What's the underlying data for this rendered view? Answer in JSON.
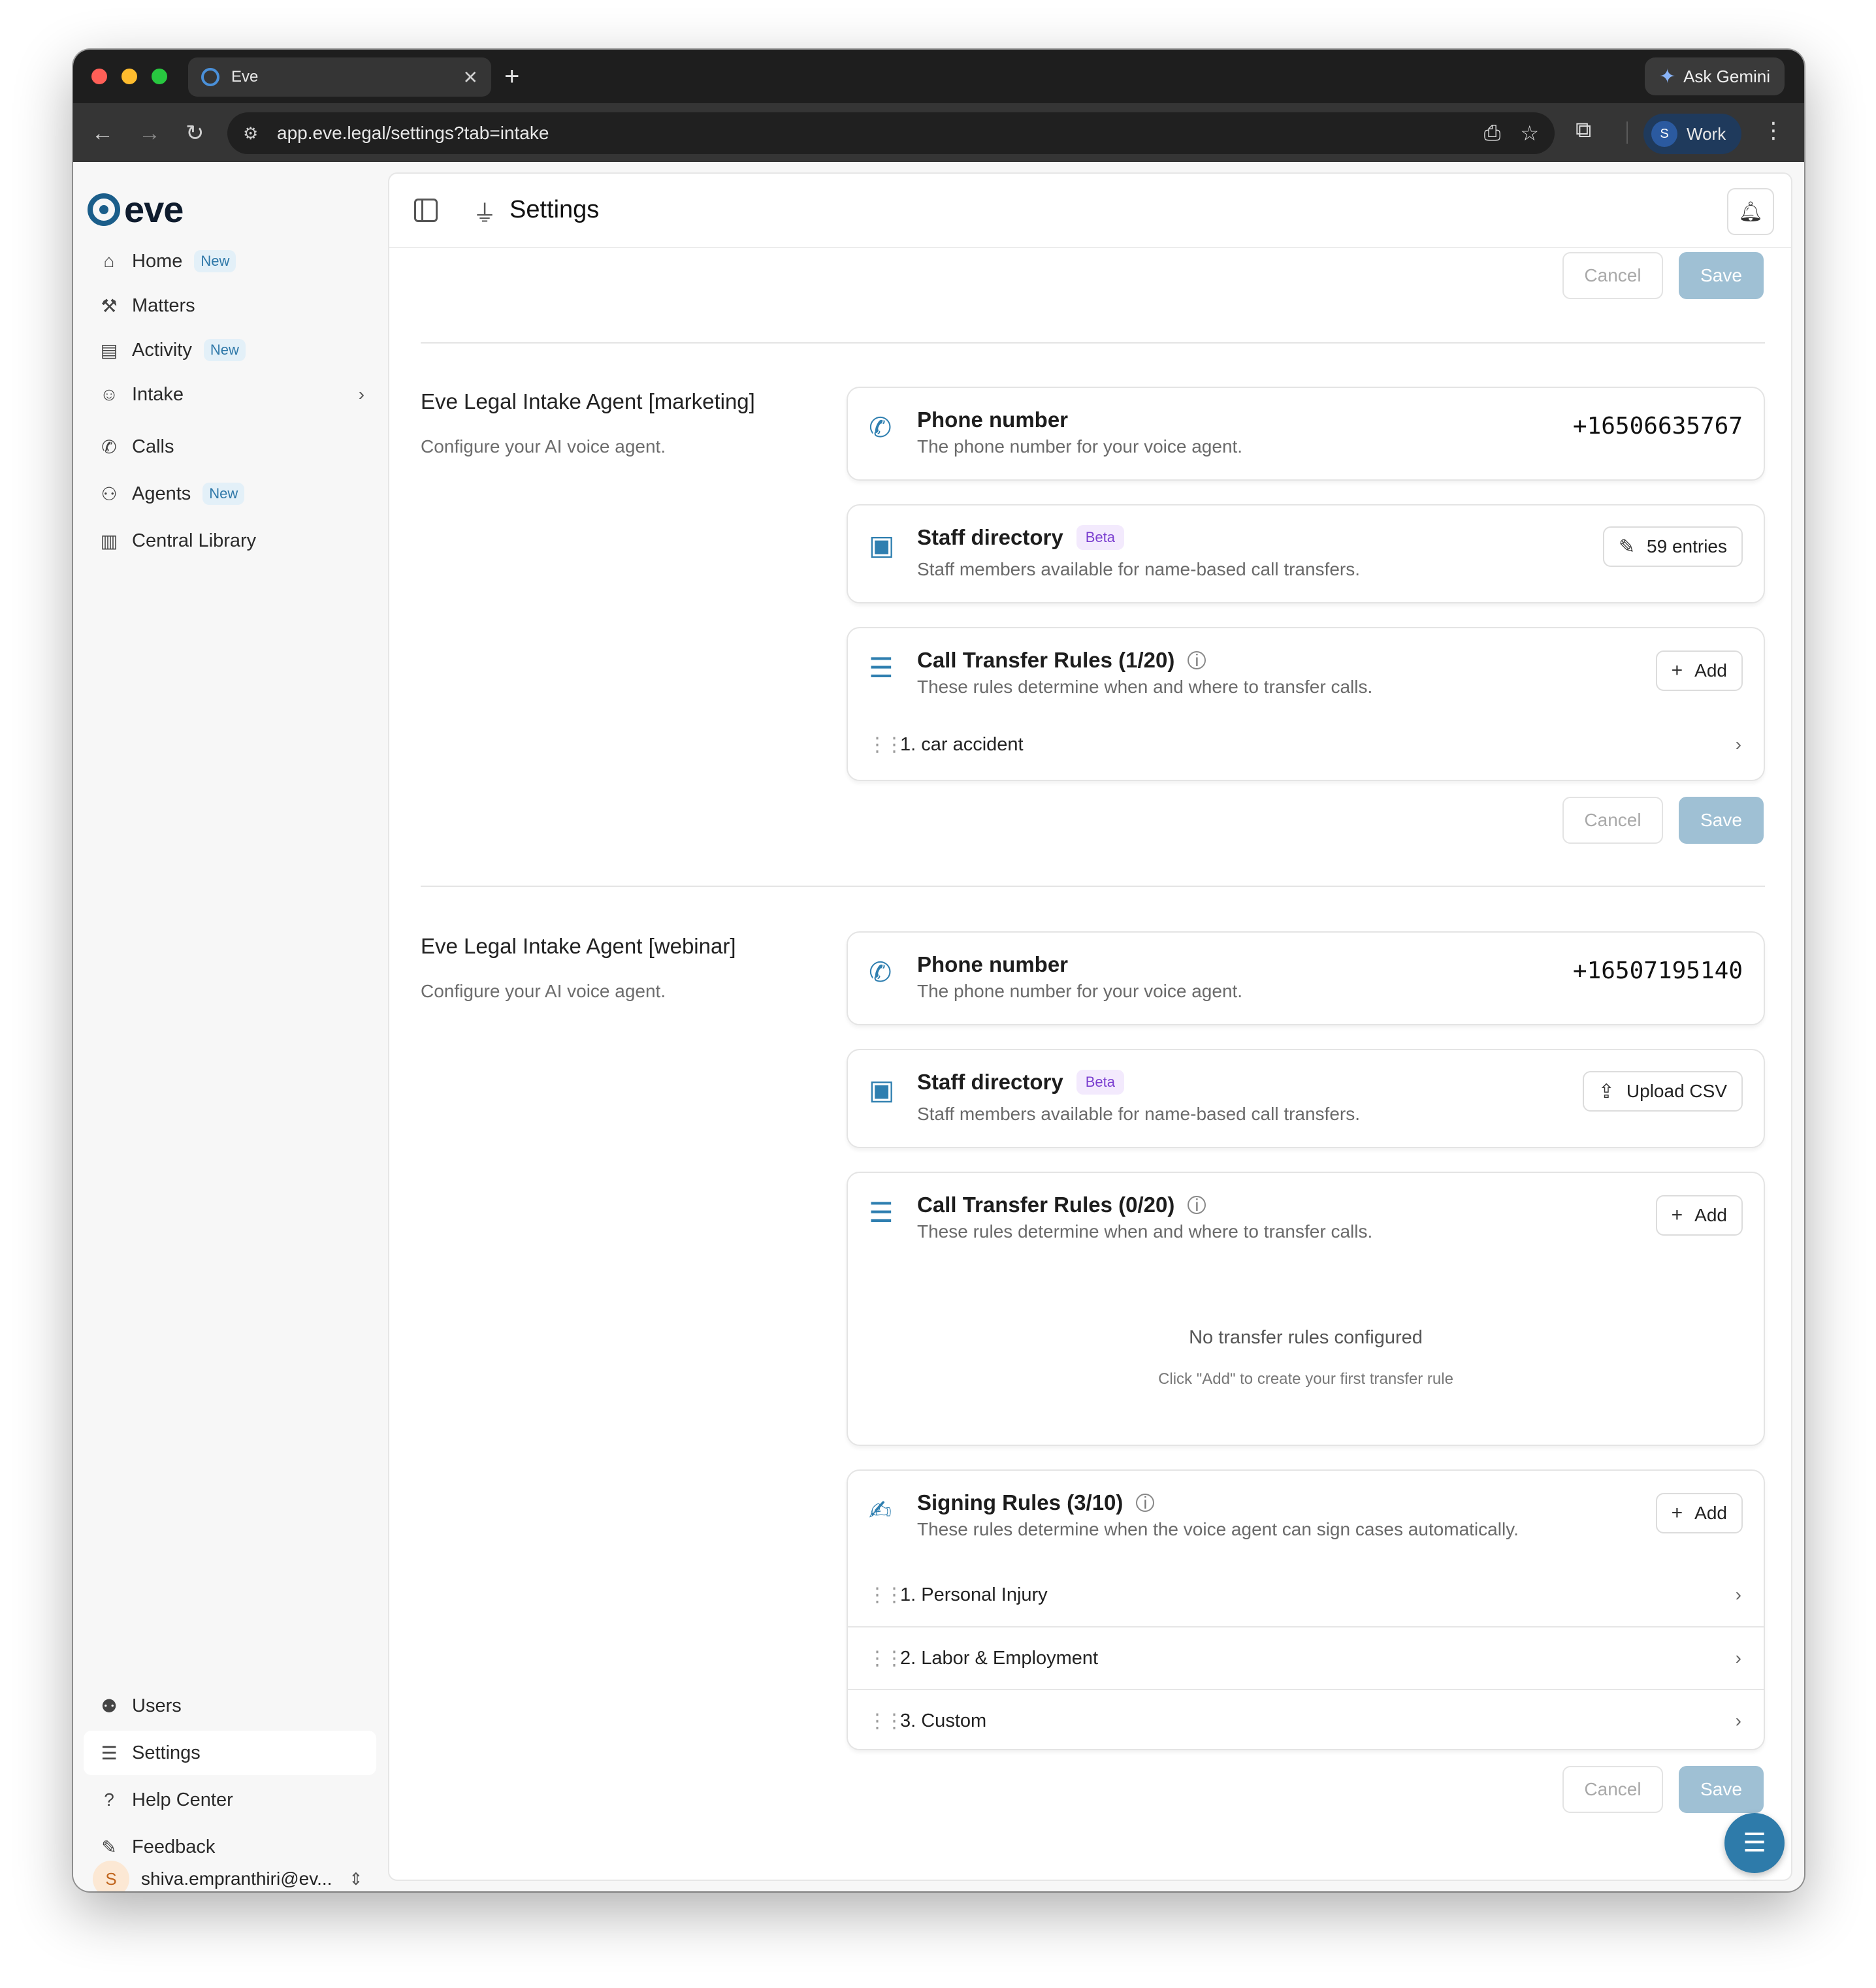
{
  "browser": {
    "tab_title": "Eve",
    "url": "app.eve.legal/settings?tab=intake",
    "ask_gemini": "Ask Gemini",
    "profile_initial": "S",
    "profile_label": "Work"
  },
  "sidebar": {
    "logo_text": "eve",
    "nav": [
      {
        "label": "Home",
        "badge": "New",
        "icon": "home-icon"
      },
      {
        "label": "Matters",
        "icon": "gavel-icon"
      },
      {
        "label": "Activity",
        "badge": "New",
        "icon": "clipboard-icon"
      },
      {
        "label": "Intake",
        "icon": "user-plus-icon"
      },
      {
        "label": "Calls",
        "icon": "phone-icon"
      },
      {
        "label": "Agents",
        "badge": "New",
        "icon": "bot-icon"
      },
      {
        "label": "Central Library",
        "icon": "library-icon"
      }
    ],
    "bottom_nav": [
      {
        "label": "Users",
        "icon": "users-icon"
      },
      {
        "label": "Settings",
        "icon": "sliders-icon"
      },
      {
        "label": "Help Center",
        "icon": "help-icon"
      },
      {
        "label": "Feedback",
        "icon": "feedback-icon"
      }
    ],
    "user": {
      "initial": "S",
      "email": "shiva.empranthiri@ev..."
    }
  },
  "header": {
    "title": "Settings"
  },
  "actions": {
    "cancel": "Cancel",
    "save": "Save"
  },
  "agents": [
    {
      "title": "Eve Legal Intake Agent [marketing]",
      "subtitle": "Configure your AI voice agent.",
      "phone": {
        "title": "Phone number",
        "subtitle": "The phone number for your voice agent.",
        "value": "+16506635767"
      },
      "staff": {
        "title": "Staff directory",
        "badge": "Beta",
        "subtitle": "Staff members available for name-based call transfers.",
        "button": "59 entries"
      },
      "transfer": {
        "title": "Call Transfer Rules (1/20)",
        "subtitle": "These rules determine when and where to transfer calls.",
        "add": "Add",
        "rules": [
          "1. car accident"
        ]
      }
    },
    {
      "title": "Eve Legal Intake Agent [webinar]",
      "subtitle": "Configure your AI voice agent.",
      "phone": {
        "title": "Phone number",
        "subtitle": "The phone number for your voice agent.",
        "value": "+16507195140"
      },
      "staff": {
        "title": "Staff directory",
        "badge": "Beta",
        "subtitle": "Staff members available for name-based call transfers.",
        "button": "Upload CSV"
      },
      "transfer": {
        "title": "Call Transfer Rules (0/20)",
        "subtitle": "These rules determine when and where to transfer calls.",
        "add": "Add",
        "empty_title": "No transfer rules configured",
        "empty_sub": "Click \"Add\" to create your first transfer rule"
      },
      "signing": {
        "title": "Signing Rules (3/10)",
        "subtitle": "These rules determine when the voice agent can sign cases automatically.",
        "add": "Add",
        "rules": [
          "1. Personal Injury",
          "2. Labor & Employment",
          "3. Custom"
        ]
      }
    }
  ],
  "colors": {
    "accent": "#2f7fb0",
    "save_disabled": "#9fc0d4",
    "beta": "#7b3fd0",
    "new_badge": "#2f78a8"
  }
}
